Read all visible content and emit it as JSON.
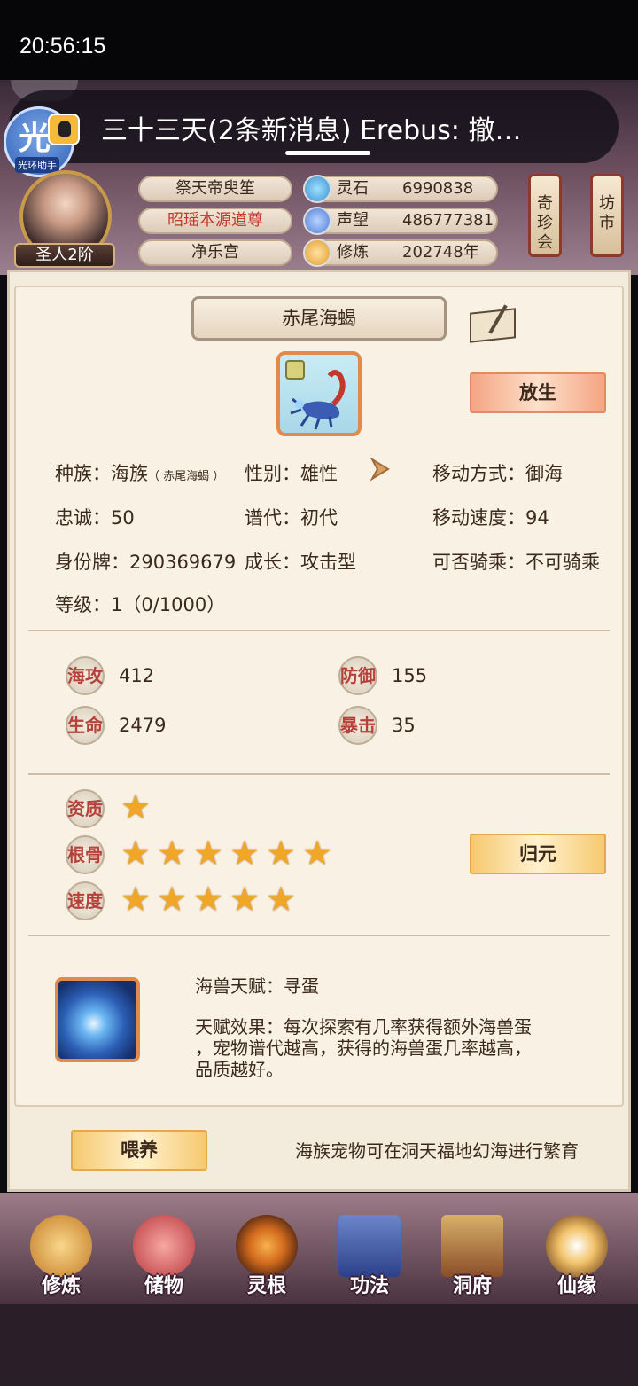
{
  "status_bar": {
    "time": "20:56:15"
  },
  "notification": {
    "text": "三十三天(2条新消息) Erebus: 撤…",
    "helper_label": "光环助手",
    "helper_glyph": "光"
  },
  "player": {
    "rank": "圣人2阶",
    "titles": [
      "祭天帝臾笙",
      "昭瑶本源道尊",
      "净乐宫"
    ],
    "title_highlight_color": "#c0392b",
    "stats": [
      {
        "icon": "spirit-stone-icon",
        "label": "灵石",
        "value": "6990838"
      },
      {
        "icon": "prestige-icon",
        "label": "声望",
        "value": "486777381"
      },
      {
        "icon": "cultivation-icon",
        "label": "修炼",
        "value": "202748年"
      }
    ],
    "side_buttons": [
      "奇珍会",
      "坊市"
    ]
  },
  "pet": {
    "name": "赤尾海蝎",
    "release_label": "放生",
    "attributes": [
      {
        "key": "种族：",
        "value": "海族",
        "sub": "（ 赤尾海蝎 ）"
      },
      {
        "key": "性别：",
        "value": "雄性"
      },
      {
        "key": "移动方式：",
        "value": "御海"
      },
      {
        "key": "忠诚：",
        "value": "50"
      },
      {
        "key": "谱代：",
        "value": "初代"
      },
      {
        "key": "移动速度：",
        "value": "94"
      },
      {
        "key": "身份牌：",
        "value": "290369679"
      },
      {
        "key": "成长：",
        "value": "攻击型"
      },
      {
        "key": "可否骑乘：",
        "value": "不可骑乘"
      },
      {
        "key": "等级：",
        "value": "1（0/1000）"
      }
    ],
    "combat": [
      {
        "label": "海攻",
        "value": "412"
      },
      {
        "label": "防御",
        "value": "155"
      },
      {
        "label": "生命",
        "value": "2479"
      },
      {
        "label": "暴击",
        "value": "35"
      }
    ],
    "qualities": [
      {
        "label": "资质",
        "stars": 1
      },
      {
        "label": "根骨",
        "stars": 6
      },
      {
        "label": "速度",
        "stars": 5
      }
    ],
    "reset_label": "归元",
    "talent_name": "海兽天赋：寻蛋",
    "talent_effect_lines": [
      "天赋效果：每次探索有几率获得额外海兽蛋",
      "，宠物谱代越高，获得的海兽蛋几率越高，",
      "品质越好。"
    ]
  },
  "feed": {
    "button": "喂养",
    "tip": "海族宠物可在洞天福地幻海进行繁育"
  },
  "nav": [
    {
      "label": "修炼",
      "icon": "meditation-icon"
    },
    {
      "label": "储物",
      "icon": "storage-bag-icon"
    },
    {
      "label": "灵根",
      "icon": "spirit-root-icon"
    },
    {
      "label": "功法",
      "icon": "technique-book-icon"
    },
    {
      "label": "洞府",
      "icon": "cave-dwelling-icon"
    },
    {
      "label": "仙缘",
      "icon": "immortal-fate-icon"
    }
  ]
}
